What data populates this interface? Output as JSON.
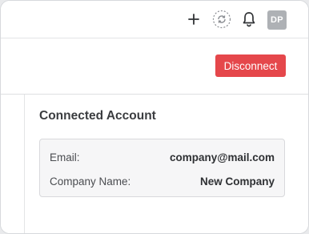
{
  "header": {
    "icons": [
      "plus-icon",
      "sync-icon",
      "bell-icon"
    ],
    "avatar_initials": "DP"
  },
  "actions": {
    "disconnect_label": "Disconnect",
    "disconnect_color": "#e5474b"
  },
  "connected_account": {
    "title": "Connected Account",
    "rows": [
      {
        "label": "Email:",
        "value": "company@mail.com"
      },
      {
        "label": "Company Name:",
        "value": "New Company"
      }
    ]
  }
}
